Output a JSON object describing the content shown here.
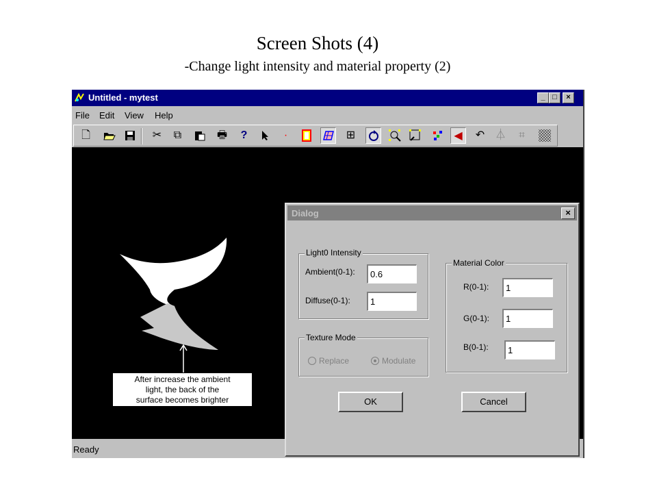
{
  "slide": {
    "title": "Screen Shots (4)",
    "subtitle": "-Change light intensity and material property (2)"
  },
  "window": {
    "title": "Untitled - mytest",
    "controls": {
      "minimize": "_",
      "maximize": "□",
      "close": "×"
    }
  },
  "menu": [
    "File",
    "Edit",
    "View",
    "Help"
  ],
  "toolbar": {
    "icons": [
      "new-icon",
      "open-icon",
      "save-icon",
      "cut-icon",
      "copy-icon",
      "paste-icon",
      "print-icon",
      "help-icon",
      "select-arrow-icon",
      "point-icon",
      "frame-icon",
      "surface-icon",
      "grid-icon",
      "rotate-icon",
      "zoom-in-icon",
      "zoom-out-icon",
      "color-points-icon",
      "back-icon",
      "undo-icon",
      "light-icon",
      "box-icon",
      "texture-icon"
    ],
    "pressed": [
      "surface-icon",
      "rotate-icon",
      "back-icon"
    ]
  },
  "status": {
    "text": "Ready"
  },
  "annotation": {
    "lines": [
      "After increase the ambient",
      "light, the back of the",
      "surface becomes brighter"
    ]
  },
  "surface_colors": {
    "front": "#ffffff",
    "back": "#c8c8c8",
    "background": "#000000"
  },
  "dialog": {
    "title": "Dialog",
    "close": "×",
    "light_group": {
      "label": "Light0 Intensity",
      "ambient_label": "Ambient(0-1):",
      "ambient_value": "0.6",
      "diffuse_label": "Diffuse(0-1):",
      "diffuse_value": "1"
    },
    "texture_group": {
      "label": "Texture Mode",
      "replace_label": "Replace",
      "modulate_label": "Modulate",
      "selected": "Modulate"
    },
    "material_group": {
      "label": "Material Color",
      "r_label": "R(0-1):",
      "r_value": "1",
      "g_label": "G(0-1):",
      "g_value": "1",
      "b_label": "B(0-1):",
      "b_value": "1"
    },
    "ok_label": "OK",
    "cancel_label": "Cancel"
  }
}
